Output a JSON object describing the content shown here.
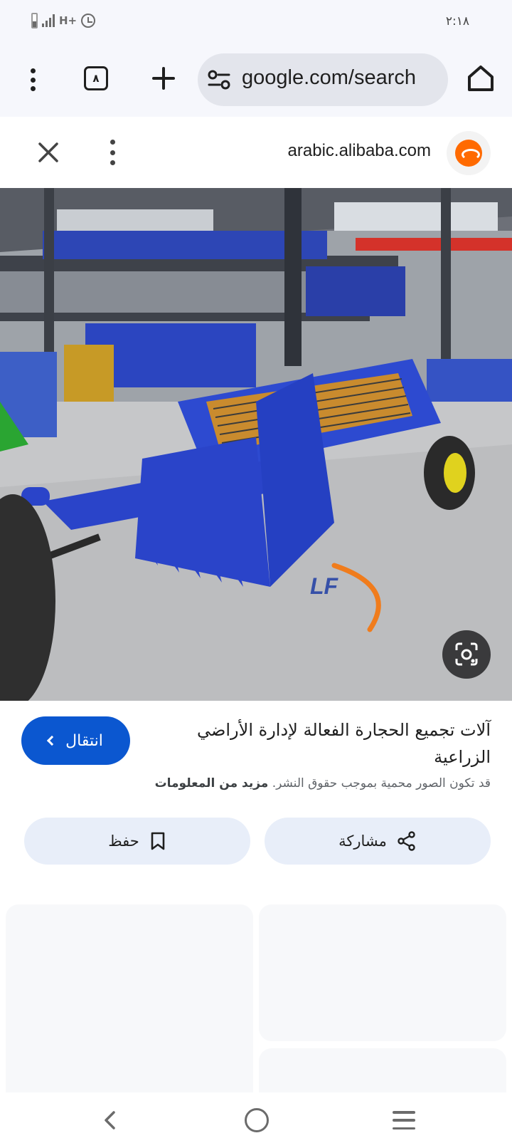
{
  "status_bar": {
    "network": "H+",
    "time": "٢:١٨"
  },
  "toolbar": {
    "tab_count": "٨",
    "url": "google.com/search"
  },
  "site_bar": {
    "domain": "arabic.alibaba.com",
    "favicon": "alibaba-logo"
  },
  "image_viewer": {
    "image_description": "blue potato harvester machine in factory warehouse",
    "watermark": "LF"
  },
  "result": {
    "title": "آلات تجميع الحجارة الفعالة لإدارة الأراضي الزراعية",
    "visit_label": "انتقال",
    "copyright_text": "قد تكون الصور محمية بموجب حقوق النشر.",
    "more_info_label": "مزيد من المعلومات",
    "share_label": "مشاركة",
    "save_label": "حفظ"
  },
  "colors": {
    "accent": "#0b57d0",
    "pill_bg": "#e8eef9",
    "machine_blue": "#2a44c9"
  }
}
